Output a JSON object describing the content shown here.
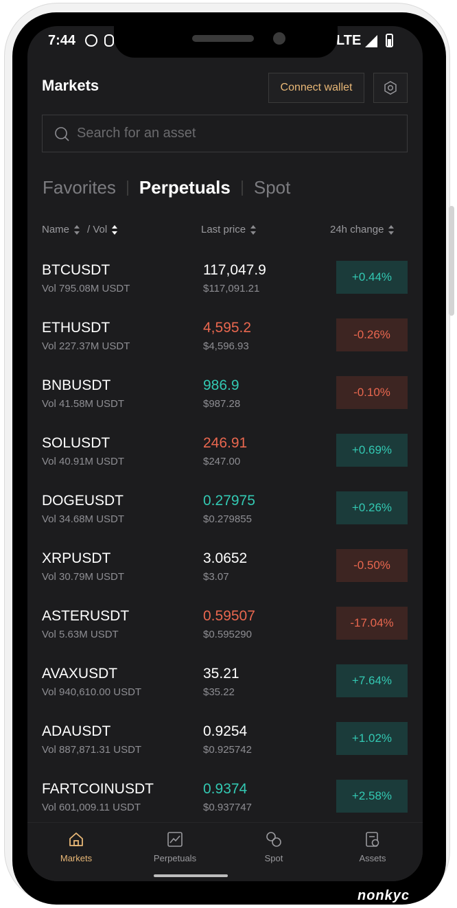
{
  "status_bar": {
    "time": "7:44",
    "network": "LTE"
  },
  "header": {
    "title": "Markets",
    "connect_label": "Connect wallet"
  },
  "search": {
    "placeholder": "Search for an asset"
  },
  "tabs": [
    {
      "label": "Favorites",
      "active": false
    },
    {
      "label": "Perpetuals",
      "active": true
    },
    {
      "label": "Spot",
      "active": false
    }
  ],
  "columns": {
    "name": "Name",
    "vol": "/ Vol",
    "last_price": "Last price",
    "change": "24h change"
  },
  "rows": [
    {
      "symbol": "BTCUSDT",
      "volume": "Vol 795.08M USDT",
      "price": "117,047.9",
      "price_usd": "$117,091.21",
      "change": "+0.44%",
      "price_color": "white",
      "dir": "pos"
    },
    {
      "symbol": "ETHUSDT",
      "volume": "Vol 227.37M USDT",
      "price": "4,595.2",
      "price_usd": "$4,596.93",
      "change": "-0.26%",
      "price_color": "red",
      "dir": "neg"
    },
    {
      "symbol": "BNBUSDT",
      "volume": "Vol 41.58M USDT",
      "price": "986.9",
      "price_usd": "$987.28",
      "change": "-0.10%",
      "price_color": "green",
      "dir": "neg"
    },
    {
      "symbol": "SOLUSDT",
      "volume": "Vol 40.91M USDT",
      "price": "246.91",
      "price_usd": "$247.00",
      "change": "+0.69%",
      "price_color": "red",
      "dir": "pos"
    },
    {
      "symbol": "DOGEUSDT",
      "volume": "Vol 34.68M USDT",
      "price": "0.27975",
      "price_usd": "$0.279855",
      "change": "+0.26%",
      "price_color": "green",
      "dir": "pos"
    },
    {
      "symbol": "XRPUSDT",
      "volume": "Vol 30.79M USDT",
      "price": "3.0652",
      "price_usd": "$3.07",
      "change": "-0.50%",
      "price_color": "white",
      "dir": "neg"
    },
    {
      "symbol": "ASTERUSDT",
      "volume": "Vol 5.63M USDT",
      "price": "0.59507",
      "price_usd": "$0.595290",
      "change": "-17.04%",
      "price_color": "red",
      "dir": "neg"
    },
    {
      "symbol": "AVAXUSDT",
      "volume": "Vol 940,610.00 USDT",
      "price": "35.21",
      "price_usd": "$35.22",
      "change": "+7.64%",
      "price_color": "white",
      "dir": "pos"
    },
    {
      "symbol": "ADAUSDT",
      "volume": "Vol 887,871.31 USDT",
      "price": "0.9254",
      "price_usd": "$0.925742",
      "change": "+1.02%",
      "price_color": "white",
      "dir": "pos"
    },
    {
      "symbol": "FARTCOINUSDT",
      "volume": "Vol 601,009.11 USDT",
      "price": "0.9374",
      "price_usd": "$0.937747",
      "change": "+2.58%",
      "price_color": "green",
      "dir": "pos"
    }
  ],
  "nav": [
    {
      "label": "Markets",
      "icon": "home-icon",
      "active": true
    },
    {
      "label": "Perpetuals",
      "icon": "chart-icon",
      "active": false
    },
    {
      "label": "Spot",
      "icon": "swap-icon",
      "active": false
    },
    {
      "label": "Assets",
      "icon": "assets-icon",
      "active": false
    }
  ],
  "watermark": "nonkyc",
  "colors": {
    "accent": "#e9b877",
    "positive": "#33c9b3",
    "negative": "#e9674f",
    "background": "#1c1c1e"
  }
}
